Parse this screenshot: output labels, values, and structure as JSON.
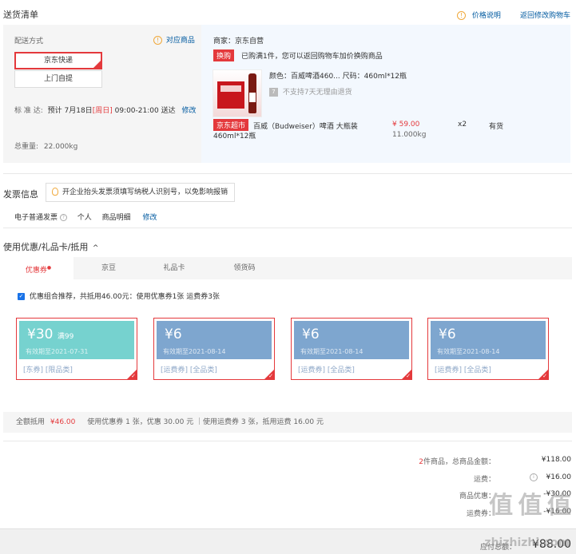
{
  "header": {
    "title": "送货清单",
    "price_note": "价格说明",
    "back_to_cart": "返回修改购物车"
  },
  "shipping": {
    "method_label": "配送方式",
    "matching_goods": "对应商品",
    "options": [
      "京东快递",
      "上门自提"
    ],
    "standard_label": "标 准 达:",
    "schedule_prefix": "预计 7月18日",
    "schedule_day": "[周日]",
    "schedule_time": "09:00-21:00 送达",
    "modify": "修改",
    "weight_label": "总重量:",
    "weight_value": "22.000kg"
  },
  "shop": {
    "merchant": "商家：京东自营",
    "promo_tag": "换购",
    "promo_text": "已购满1件，您可以返回购物车加价换购商品",
    "spec": "颜色：百威啤酒460... 尺码：460ml*12瓶",
    "no_return": "不支持7天无理由退货",
    "supermarket_tag": "京东超市",
    "product_name": "百威（Budweiser）啤酒 大瓶装",
    "product_name_2": "460ml*12瓶",
    "price": "¥ 59.00",
    "weight": "11.000kg",
    "quantity": "x2",
    "stock": "有货"
  },
  "invoice": {
    "title": "发票信息",
    "tip": "开企业抬头发票须填写纳税人识别号，以免影响报销",
    "type": "电子普通发票",
    "holder": "个人",
    "content": "商品明细",
    "modify": "修改"
  },
  "discount": {
    "title": "使用优惠/礼品卡/抵用",
    "tabs": [
      "优惠券",
      "京豆",
      "礼品卡",
      "领货码"
    ],
    "combo_text": "优惠组合推荐，共抵用46.00元：使用优惠券1张 运费券3张",
    "coupons": [
      {
        "value": "¥30",
        "condition": "满99",
        "expiry": "有效期至2021-07-31",
        "kinds": "[东券] [限品类]",
        "color": "#76d2cf"
      },
      {
        "value": "¥6",
        "condition": "",
        "expiry": "有效期至2021-08-14",
        "kinds": "[运费券] [全品类]",
        "color": "#7ea6cf"
      },
      {
        "value": "¥6",
        "condition": "",
        "expiry": "有效期至2021-08-14",
        "kinds": "[运费券] [全品类]",
        "color": "#7ea6cf"
      },
      {
        "value": "¥6",
        "condition": "",
        "expiry": "有效期至2021-08-14",
        "kinds": "[运费券] [全品类]",
        "color": "#7ea6cf"
      }
    ],
    "summary_label": "全额抵用",
    "summary_amount": "¥46.00",
    "summary_detail": "使用优惠券 1 张，优惠 30.00 元 ｜使用运费券 3 张，抵用运费 16.00 元"
  },
  "totals": {
    "count": "2",
    "items_label": "件商品，总商品金额：",
    "items_value": "¥118.00",
    "freight_label": "运费：",
    "freight_value": "¥16.00",
    "row3_label": "商品优惠：",
    "row3_value": "-¥30.00",
    "row4_label": "运费券：",
    "row4_value": "-¥16.00",
    "payable_label": "应付总额：",
    "payable_value": "¥88.00"
  },
  "watermark": {
    "logo": "值 值 值",
    "url": "zhizhizhi.com"
  }
}
